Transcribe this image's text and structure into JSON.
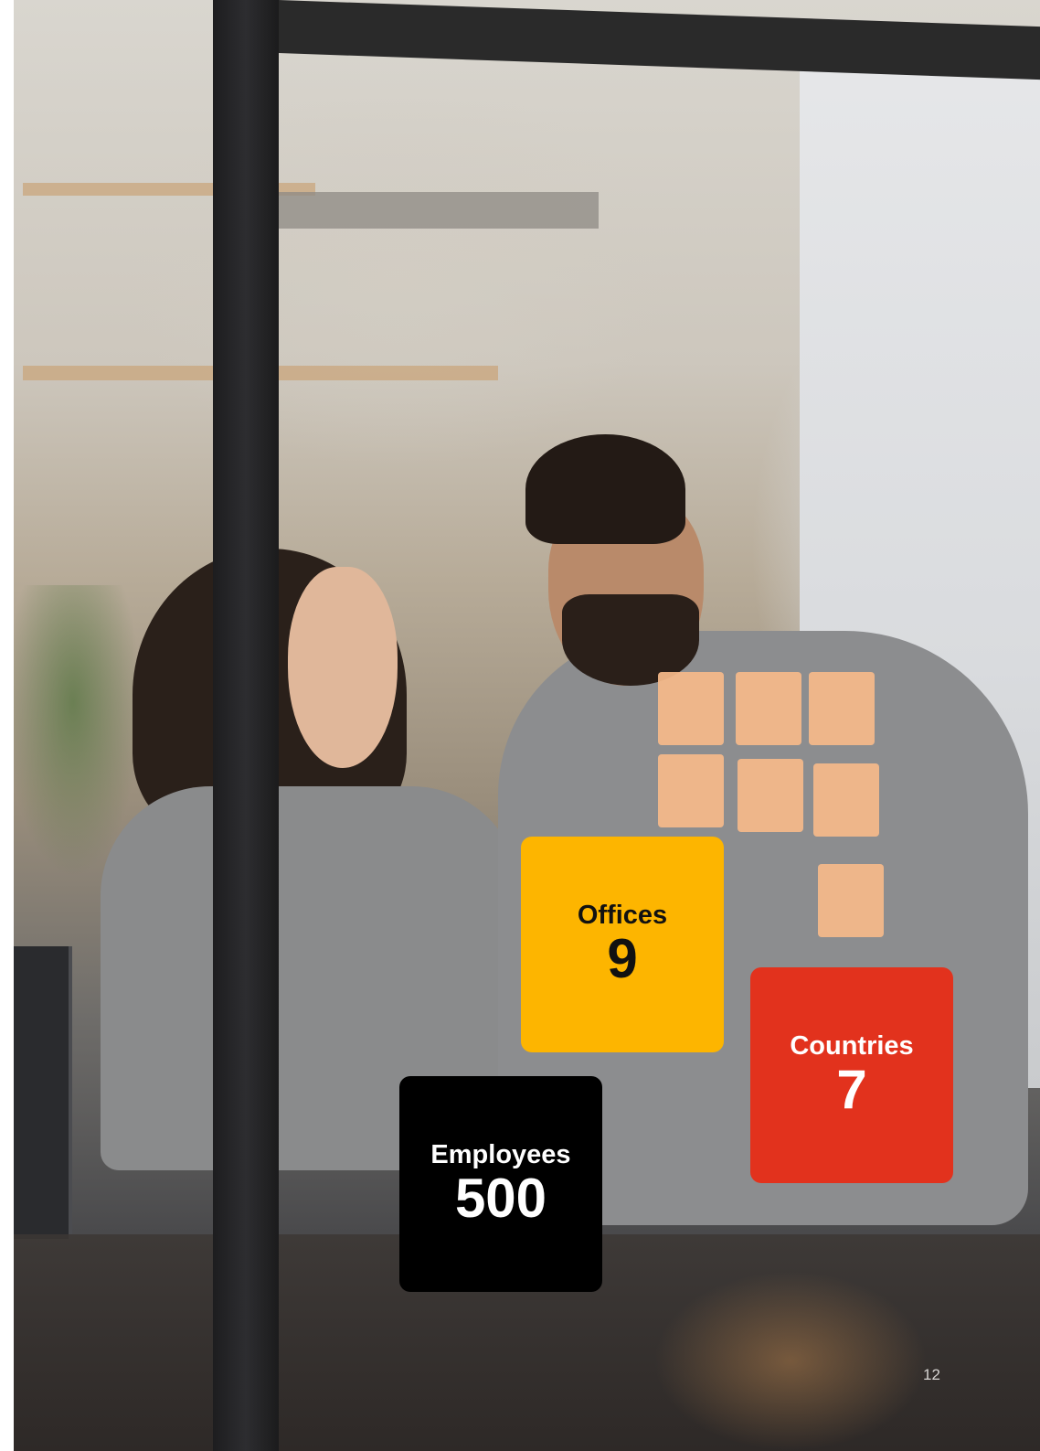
{
  "stats": {
    "offices": {
      "label": "Offices",
      "value": "9"
    },
    "countries": {
      "label": "Countries",
      "value": "7"
    },
    "employees": {
      "label": "Employees",
      "value": "500"
    }
  },
  "page_number": "12",
  "colors": {
    "offices_card": "#fdb500",
    "countries_card": "#e2321d",
    "employees_card": "#000000"
  }
}
